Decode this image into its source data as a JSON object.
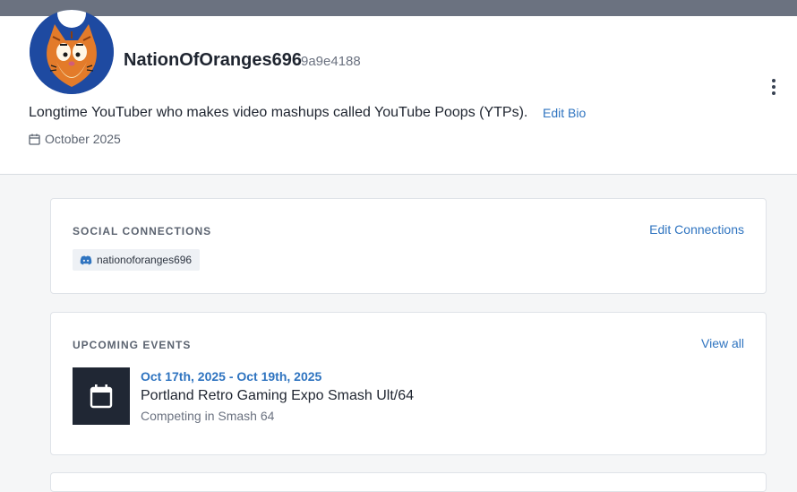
{
  "profile": {
    "username": "NationOfOranges696",
    "user_code": "9a9e4188",
    "bio": "Longtime YouTuber who makes video mashups called YouTube Poops (YTPs).",
    "edit_bio_label": "Edit Bio",
    "joined": "October 2025",
    "avatar_icon": "orange-cat-avatar",
    "menu_icon": "more-vertical-icon"
  },
  "social": {
    "title": "SOCIAL CONNECTIONS",
    "edit_label": "Edit Connections",
    "connections": [
      {
        "icon": "discord-icon",
        "handle": "nationoforanges696"
      }
    ]
  },
  "events": {
    "title": "UPCOMING EVENTS",
    "view_all_label": "View all",
    "items": [
      {
        "date_range": "Oct 17th, 2025 - Oct 19th, 2025",
        "name": "Portland Retro Gaming Expo Smash Ult/64",
        "detail": "Competing in Smash 64",
        "icon": "calendar-icon"
      }
    ]
  },
  "colors": {
    "accent": "#2f74c0",
    "topbar": "#6b7280",
    "thumb_bg": "#202734"
  }
}
